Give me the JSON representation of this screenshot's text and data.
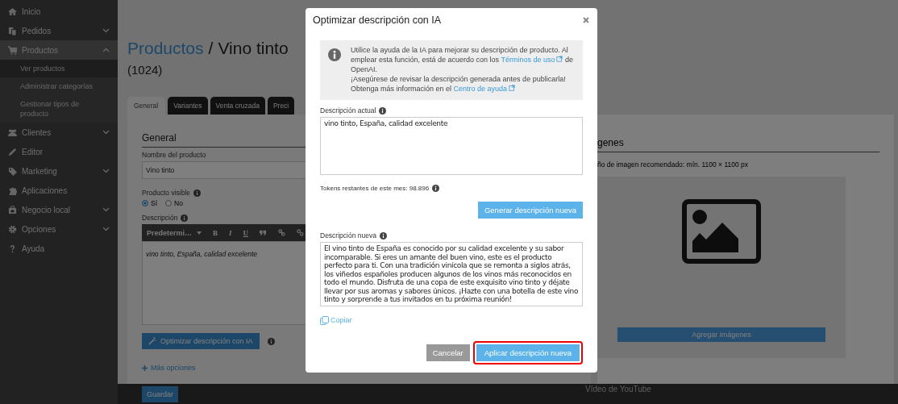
{
  "sidebar": {
    "items": [
      {
        "label": "Inicio",
        "selected": false
      },
      {
        "label": "Pedidos",
        "expanded": false,
        "selected": false
      },
      {
        "label": "Productos",
        "expanded": true,
        "selected": true,
        "children": [
          {
            "label": "Ver productos",
            "selected": true
          },
          {
            "label": "Administrar categorías",
            "selected": false
          },
          {
            "label": "Gestionar tipos de producto",
            "selected": false
          }
        ]
      },
      {
        "label": "Clientes",
        "expanded": false,
        "selected": false
      },
      {
        "label": "Editor",
        "selected": false
      },
      {
        "label": "Marketing",
        "expanded": false,
        "selected": false
      },
      {
        "label": "Aplicaciones",
        "selected": false
      },
      {
        "label": "Negocio local",
        "expanded": false,
        "selected": false
      },
      {
        "label": "Opciones",
        "expanded": false,
        "selected": false
      },
      {
        "label": "Ayuda",
        "selected": false
      }
    ]
  },
  "header": {
    "link": "Productos",
    "separator": "/",
    "name": "Vino tinto",
    "count": "(1024)"
  },
  "tabs": [
    {
      "label": "General",
      "selected": true
    },
    {
      "label": "Variantes",
      "selected": false
    },
    {
      "label": "Venta cruzada",
      "selected": false
    },
    {
      "label": "Preci",
      "selected": false
    }
  ],
  "general": {
    "heading": "General",
    "name_label": "Nombre del producto",
    "name_value": "Vino tinto",
    "visible_label": "Producto visible",
    "visible_options": [
      {
        "label": "Sí",
        "selected": true
      },
      {
        "label": "No",
        "selected": false
      }
    ],
    "description_label": "Descripción",
    "format_dropdown": "Predetermi…",
    "toolbar_letters": [
      "B",
      "I",
      "U"
    ],
    "description_value": "vino tinto, España, calidad excelente",
    "optimize_button": "Optimizar descripción con IA",
    "more_options": "Más opciones"
  },
  "images": {
    "heading": "genes",
    "hint": "ño de imagen recomendado: mín. 1100 × 1100 px",
    "add_button": "Agregar imágenes"
  },
  "bottom_bar": {
    "save_button": "Guardar",
    "video_label": "Vídeo de YouTube"
  },
  "modal": {
    "title": "Optimizar descripción con IA",
    "info": [
      {
        "before": "Utilice la ayuda de la IA para mejorar su descripción de producto. Al emplear esta función, está de acuerdo con los ",
        "link": "Términos de uso",
        "after": " de OpenAI."
      },
      {
        "before": "¡Asegúrese de revisar la descripción generada antes de publicarla! Obtenga más información en el ",
        "link": "Centro de ayuda"
      }
    ],
    "current_label": "Descripción actual",
    "current_value": "vino tinto, España, calidad excelente",
    "tokens": "Tokens restantes de este mes: 98.896",
    "generate_button": "Generar descripción nueva",
    "new_label": "Descripción nueva",
    "new_value": "El vino tinto de España es conocido por su calidad excelente y su sabor incomparable. Si eres un amante del buen vino, este es el producto perfecto para ti. Con una tradición vinícola que se remonta a siglos atrás, los viñedos españoles producen algunos de los vinos más reconocidos en todo el mundo. Disfruta de una copa de este exquisito vino tinto y déjate llevar por sus aromas y sabores únicos. ¡Hazte con una botella de este vino tinto y sorprende a tus invitados en tu próxima reunión!",
    "copy_link": "Copiar",
    "cancel_button": "Cancelar",
    "apply_button": {
      "label": "Aplicar descripción nueva",
      "highlighted": true
    }
  }
}
